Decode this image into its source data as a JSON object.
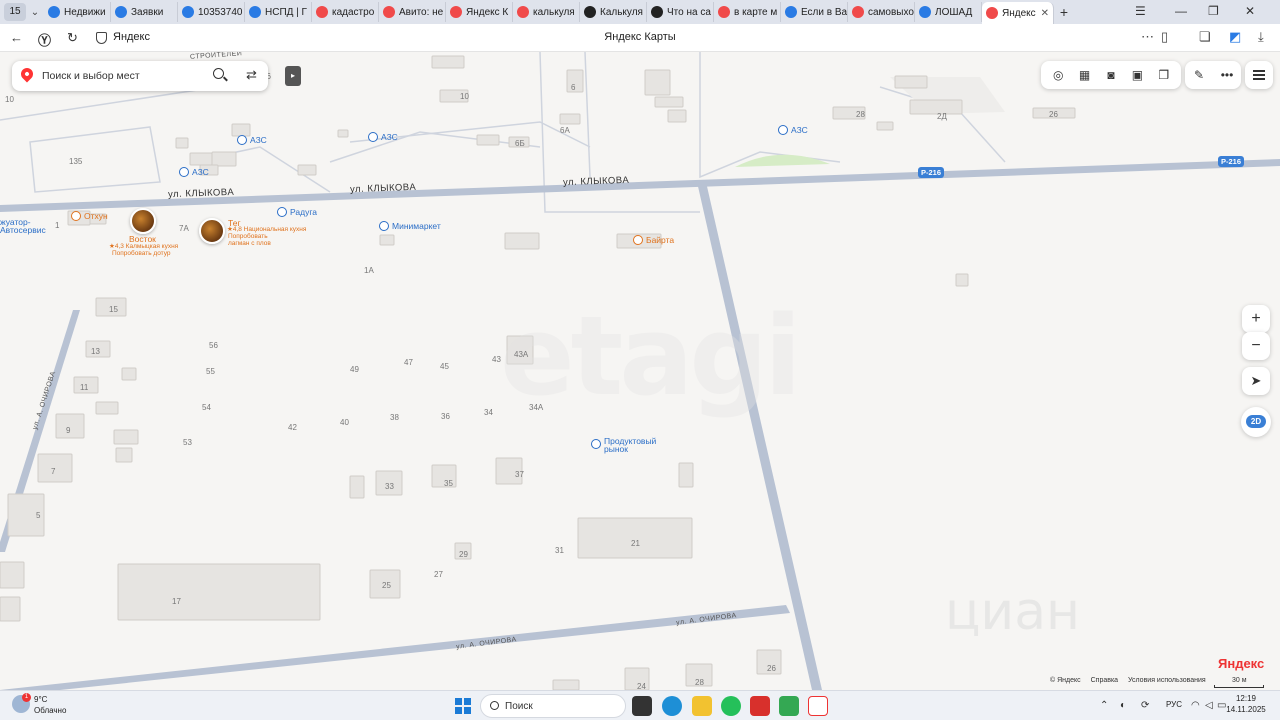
{
  "browser": {
    "tab_count": "15",
    "tabs": [
      {
        "label": "Недвижи",
        "color": "#2a7be4",
        "icon": "globe-icon"
      },
      {
        "label": "Заявки",
        "color": "#2a7be4",
        "icon": "globe-icon"
      },
      {
        "label": "10353740",
        "color": "#2a7be4",
        "icon": "globe-icon"
      },
      {
        "label": "НСПД | Г",
        "color": "#2a7be4",
        "icon": "globe-icon"
      },
      {
        "label": "кадастро",
        "color": "#f04a4a",
        "icon": "yandex-icon"
      },
      {
        "label": "Авито: не",
        "color": "#f04a4a",
        "icon": "avito-icon"
      },
      {
        "label": "Яндекс К",
        "color": "#f04a4a",
        "icon": "pin-icon"
      },
      {
        "label": "калькуля",
        "color": "#f04a4a",
        "icon": "yandex-icon"
      },
      {
        "label": "Калькуля",
        "color": "#222222",
        "icon": "tiktok-icon"
      },
      {
        "label": "Что на са",
        "color": "#222222",
        "icon": "plus-icon"
      },
      {
        "label": "в карте м",
        "color": "#f04a4a",
        "icon": "yandex-icon"
      },
      {
        "label": "Если в Ва",
        "color": "#2a7be4",
        "icon": "vk-icon"
      },
      {
        "label": "самовыхо",
        "color": "#f04a4a",
        "icon": "yandex-icon"
      },
      {
        "label": "ЛОШАД",
        "color": "#2a7be4",
        "icon": "vk-icon"
      },
      {
        "label": "Яндекс",
        "color": "#f04a4a",
        "icon": "pin-icon",
        "active": true
      }
    ],
    "new_tab": "+",
    "site_name": "Яндекс",
    "page_title": "Яндекс Карты"
  },
  "map_ui": {
    "search_placeholder": "Поиск и выбор мест",
    "zoom_in": "+",
    "zoom_out": "−",
    "mode_2d": "2D",
    "yandex_logo": "Яндекс",
    "copyright": [
      "© Яндекс",
      "Справка",
      "Условия использования"
    ],
    "scale": "30 м",
    "watermark_etagi": "etagi",
    "watermark_cian": "циан"
  },
  "streets": {
    "klykova_1": "ул. КЛЫКОВА",
    "klykova_2": "ул. КЛЫКОВА",
    "klykova_3": "ул. КЛЫКОВА",
    "ochirova_1": "ул. А. ОЧИРОВА",
    "ochirova_2": "ул. А. ОЧИРОВА",
    "ochirova_3": "ул. А. ОЧИРОВА",
    "road_r216_a": "Р-216",
    "road_r216_b": "Р-216",
    "stroitelei": "СТРОИТЕЛЕЙ"
  },
  "pois": {
    "azs_1": "АЗС",
    "azs_2": "АЗС",
    "azs_3": "АЗС",
    "azs_4": "АЗС",
    "otkhun": "Отхун",
    "raduga": "Радуга",
    "minimarket": "Минимаркет",
    "bairta": "Байрта",
    "market_1": "Продуктовый",
    "market_2": "рынок",
    "avtoservis_1": "жуатор-",
    "avtoservis_2": "Автосервис",
    "vostok_name": "Восток",
    "vostok_rating": "★4,3 Калмыцкая кухня",
    "vostok_tip": "Попробовать дотур",
    "teg_name": "Тег",
    "teg_rating": "★4,8 Национальная кухня",
    "teg_tip_1": "Попробовать",
    "teg_tip_2": "лагман с плов"
  },
  "house_numbers": {
    "h10a": "10",
    "h10b": "10",
    "h6": "6",
    "h6a": "6А",
    "h6b": "6Б",
    "h12": "12",
    "h135": "135",
    "h7a": "7А",
    "h28": "28",
    "h2d": "2Д",
    "h26": "26",
    "h1a": "1А",
    "h1": "1",
    "h15": "15",
    "h13": "13",
    "h11": "11",
    "h9": "9",
    "h7": "7",
    "h5": "5",
    "h56": "56",
    "h55": "55",
    "h54": "54",
    "h53": "53",
    "h49": "49",
    "h47": "47",
    "h45": "45",
    "h43": "43",
    "h43a": "43А",
    "h42": "42",
    "h40": "40",
    "h38": "38",
    "h36": "36",
    "h34": "34",
    "h34a": "34А",
    "h37": "37",
    "h35": "35",
    "h33": "33",
    "h31": "31",
    "h29": "29",
    "h27": "27",
    "h25": "25",
    "h21": "21",
    "h17": "17",
    "h26b": "26",
    "h24": "24",
    "h28b": "28",
    "h16": "16"
  },
  "taskbar": {
    "temperature": "9°C",
    "weather": "Облачно",
    "weather_badge": "1",
    "search_label": "Поиск",
    "lang": "РУС",
    "time": "12:19",
    "date": "14.11.2025"
  }
}
